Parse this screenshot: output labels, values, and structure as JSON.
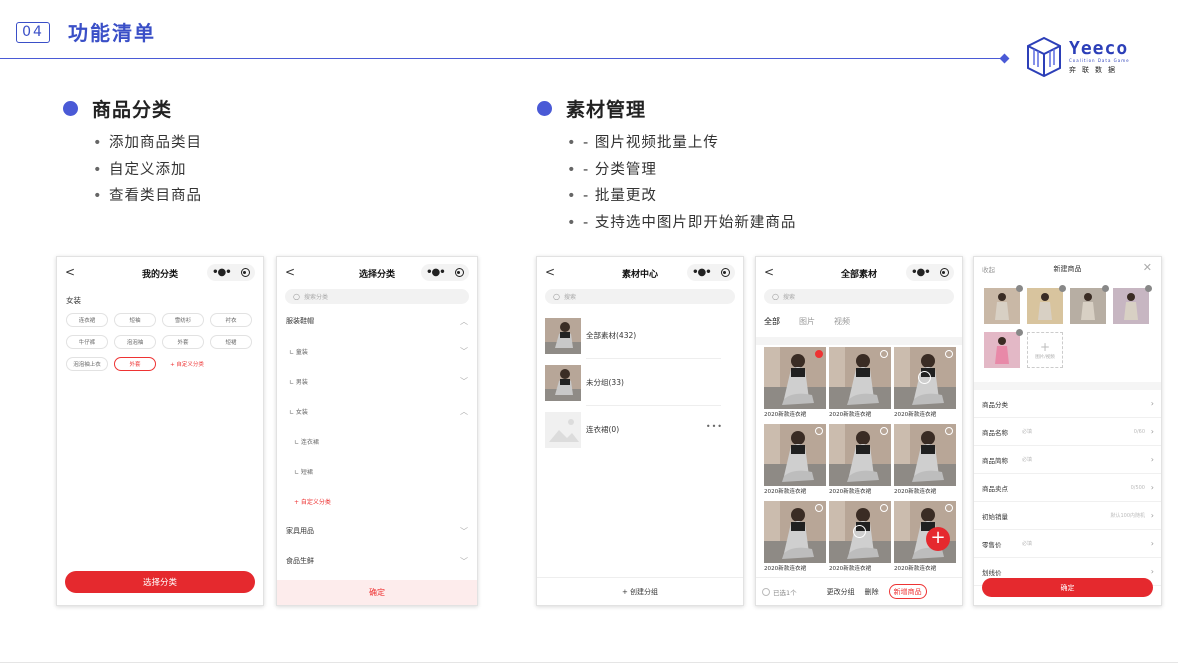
{
  "header": {
    "number": "04",
    "title": "功能清单"
  },
  "logo": {
    "word": "Yeeco",
    "sub": "Coalition Data Game",
    "cn": "弈联数据"
  },
  "sections": [
    {
      "title": "商品分类",
      "items": [
        "添加商品类目",
        "自定义添加",
        "查看类目商品"
      ]
    },
    {
      "title": "素材管理",
      "items": [
        "- 图片视频批量上传",
        "- 分类管理",
        "- 批量更改",
        "- 支持选中图片即开始新建商品"
      ]
    }
  ],
  "phone1": {
    "title": "我的分类",
    "category": "女装",
    "chips": [
      "连衣裙",
      "短袖",
      "雪纺衫",
      "衬衣",
      "牛仔裤",
      "泡泡袖",
      "外套",
      "短裙",
      "泡泡袖上衣",
      "外套",
      "+ 自定义分类"
    ],
    "selected_index": 9,
    "button": "选择分类"
  },
  "phone2": {
    "title": "选择分类",
    "search_placeholder": "搜索分类",
    "rows": [
      {
        "label": "服装鞋帽",
        "level": 1,
        "chev": "︿"
      },
      {
        "label": "∟ 童装",
        "level": 2,
        "chev": "﹀"
      },
      {
        "label": "∟ 男装",
        "level": 2,
        "chev": "﹀"
      },
      {
        "label": "∟ 女装",
        "level": 2,
        "chev": "︿"
      },
      {
        "label": "∟ 连衣裙",
        "level": 3,
        "chev": ""
      },
      {
        "label": "∟ 短裙",
        "level": 3,
        "chev": ""
      },
      {
        "label": "+ 自定义分类",
        "level": 4,
        "chev": ""
      },
      {
        "label": "家具用品",
        "level": 1,
        "chev": "﹀"
      },
      {
        "label": "食品生鲜",
        "level": 1,
        "chev": "﹀"
      }
    ],
    "confirm": "确定"
  },
  "phone3": {
    "title": "素材中心",
    "search_placeholder": "搜索",
    "folders": [
      "全部素材(432)",
      "未分组(33)",
      "连衣裙(0)"
    ],
    "more": "•••",
    "create": "+ 创建分组"
  },
  "phone4": {
    "title": "全部素材",
    "search_placeholder": "搜索",
    "tabs": [
      "全部",
      "图片",
      "视频"
    ],
    "caption": "2020新款连衣裙",
    "selected": "已选1个",
    "actions": [
      "更改分组",
      "删除"
    ],
    "new_button": "新增商品",
    "fab": "+"
  },
  "phone5": {
    "left": "收起",
    "title": "新建商品",
    "close": "✕",
    "add_label": "图片/视频",
    "fields": [
      {
        "k": "商品分类",
        "ph": "",
        "rv": ""
      },
      {
        "k": "商品名称",
        "ph": "必填",
        "rv": "0/60"
      },
      {
        "k": "商品简称",
        "ph": "必填",
        "rv": ""
      },
      {
        "k": "商品卖点",
        "ph": "",
        "rv": "0/500"
      },
      {
        "k": "初始销量",
        "ph": "",
        "rv": "默认100内随机"
      },
      {
        "k": "零售价",
        "ph": "必填",
        "rv": ""
      },
      {
        "k": "划线价",
        "ph": "",
        "rv": ""
      }
    ],
    "button": "确定"
  },
  "colors": {
    "brand": "#3a4fc7",
    "accent": "#e5292e"
  }
}
